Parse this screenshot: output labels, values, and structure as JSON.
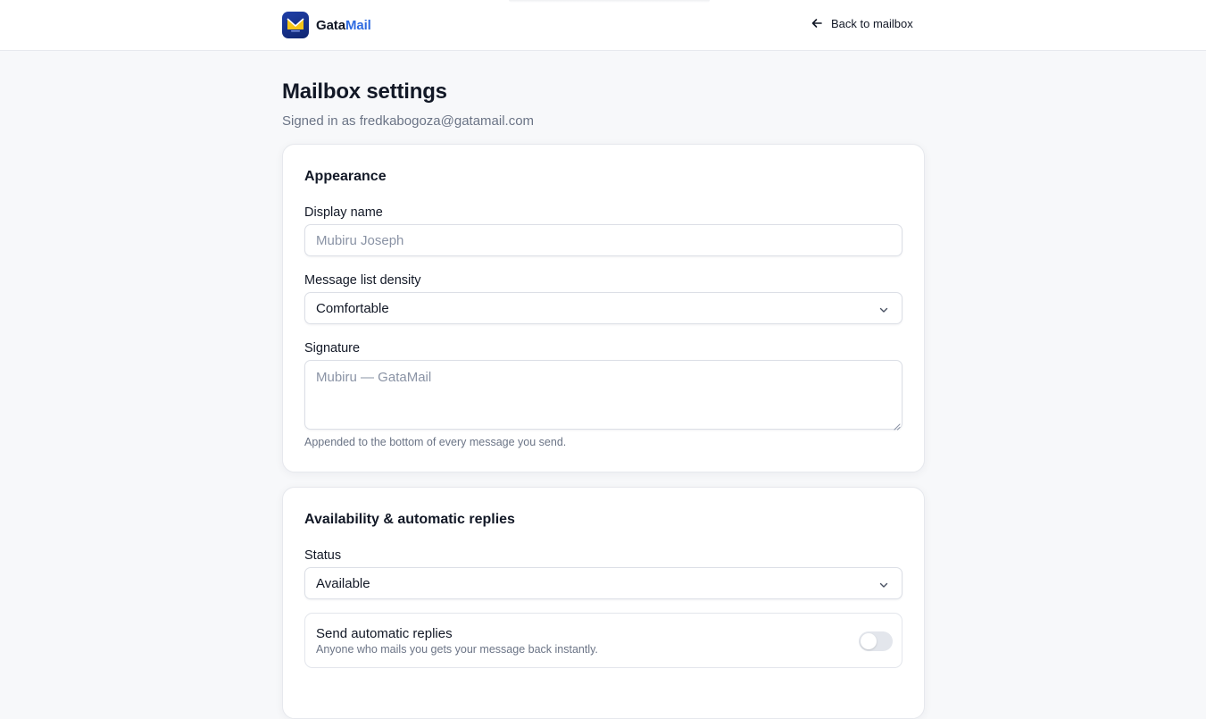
{
  "header": {
    "brand_part1": "Gata",
    "brand_part2": "Mail",
    "logo_icon": "mail-envelope-icon",
    "back_label": "Back to mailbox",
    "back_icon": "arrow-left-icon"
  },
  "page": {
    "title": "Mailbox settings",
    "subtitle": "Signed in as fredkabogoza@gatamail.com"
  },
  "appearance": {
    "title": "Appearance",
    "display_name_label": "Display name",
    "display_name_placeholder": "Mubiru Joseph",
    "density_label": "Message list density",
    "density_value": "Comfortable",
    "signature_label": "Signature",
    "signature_placeholder": "Mubiru — GataMail",
    "signature_hint": "Appended to the bottom of every message you send."
  },
  "availability": {
    "title": "Availability & automatic replies",
    "status_label": "Status",
    "status_value": "Available",
    "auto_reply_title": "Send automatic replies",
    "auto_reply_desc": "Anyone who mails you gets your message back instantly.",
    "auto_reply_enabled": false
  },
  "colors": {
    "accent": "#2f6be0",
    "logo_bg": "#1f3fa8",
    "logo_mark": "#f5c518",
    "background": "#f7f8fa"
  }
}
